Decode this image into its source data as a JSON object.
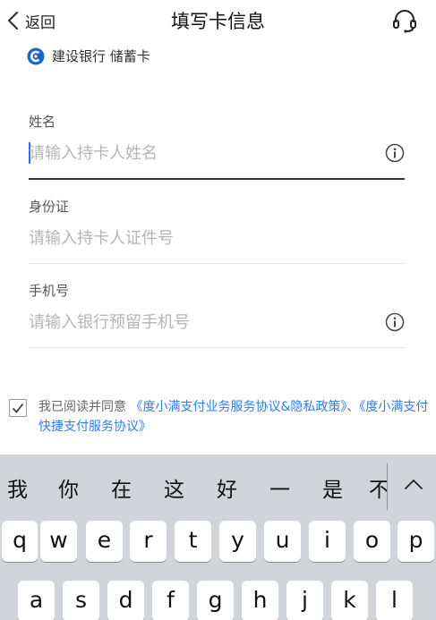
{
  "nav": {
    "back_label": "返回",
    "title": "填写卡信息",
    "service_icon": "headset-icon"
  },
  "bank": {
    "name": "建设银行 储蓄卡",
    "logo_color": "#1b66c9"
  },
  "fields": {
    "name": {
      "label": "姓名",
      "placeholder": "请输入持卡人姓名",
      "value": ""
    },
    "id": {
      "label": "身份证",
      "placeholder": "请输入持卡人证件号",
      "value": ""
    },
    "phone": {
      "label": "手机号",
      "placeholder": "请输入银行预留手机号",
      "value": ""
    }
  },
  "agreement": {
    "checked": true,
    "prefix": "我已阅读并同意",
    "link1": "《度小满支付业务服务协议&隐私政策》",
    "separator": "、",
    "link2": "《度小满支付快捷支付服务协议》",
    "link_color": "#2f7bf5"
  },
  "keyboard": {
    "candidates": [
      "我",
      "你",
      "在",
      "这",
      "好",
      "一",
      "是",
      "不"
    ],
    "row1": [
      "q",
      "w",
      "e",
      "r",
      "t",
      "y",
      "u",
      "i",
      "o",
      "p"
    ],
    "row2": [
      "a",
      "s",
      "d",
      "f",
      "g",
      "h",
      "j",
      "k",
      "l"
    ]
  }
}
